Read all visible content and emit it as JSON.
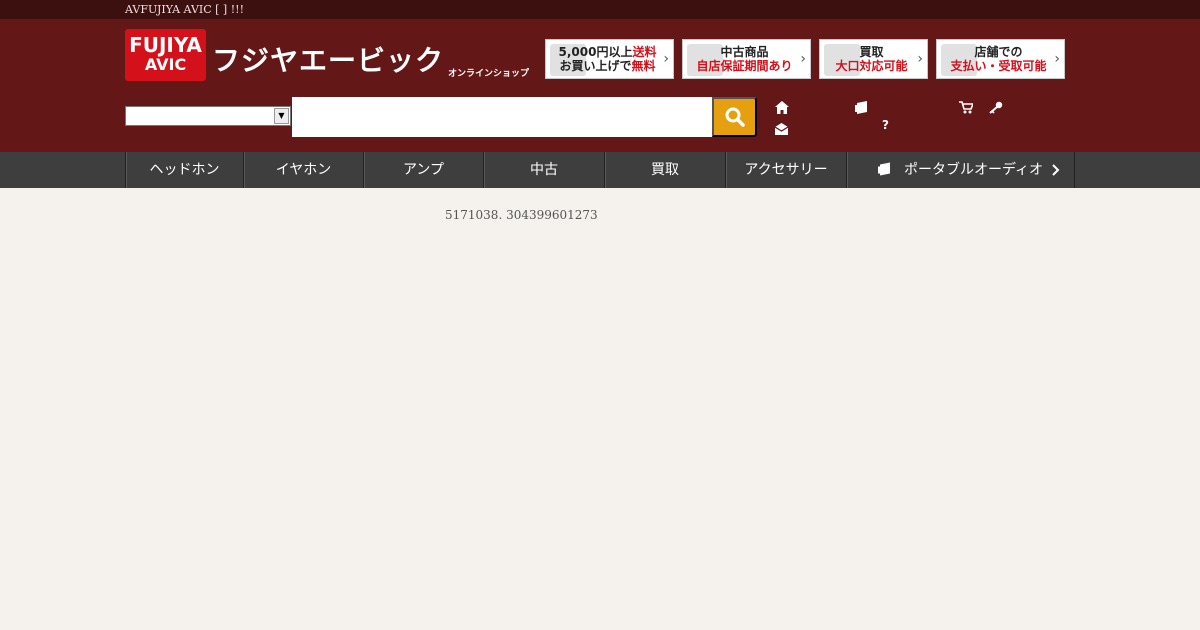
{
  "topbar": {
    "text": "AVFUJIYA AVIC [  ] !!!"
  },
  "logo": {
    "line1": "FUJIYA",
    "line2": "AVIC",
    "name": "フジヤエービック",
    "sub": "オンラインショップ"
  },
  "banners": [
    {
      "id": "free-shipping",
      "line1a": "5,000円以上",
      "line1b": "送料",
      "line2a": "お買い上げで",
      "line2b": "無料"
    },
    {
      "id": "used-warranty",
      "line1a": "中古商品",
      "line1b": "",
      "line2a": "",
      "line2b": "自店保証期間あり"
    },
    {
      "id": "buyback",
      "line1a": "買取",
      "line1b": "",
      "line2a": "",
      "line2b": "大口対応可能"
    },
    {
      "id": "store-payment",
      "line1a": "店舗での",
      "line1b": "",
      "line2a": "",
      "line2b": "支払い・受取可能"
    }
  ],
  "search": {
    "category_value": "",
    "input_value": "",
    "placeholder": ""
  },
  "user_links": [
    {
      "icon": "home-icon",
      "label": ""
    },
    {
      "icon": "store-icon",
      "label": ""
    },
    {
      "icon": "cart-icon",
      "label": ""
    },
    {
      "icon": "key-icon",
      "label": ""
    },
    {
      "icon": "mail-icon",
      "label": ""
    },
    {
      "icon": "help-icon",
      "label": "?"
    }
  ],
  "nav": [
    {
      "label": "ヘッドホン"
    },
    {
      "label": "イヤホン"
    },
    {
      "label": "アンプ"
    },
    {
      "label": "中古"
    },
    {
      "label": "買取"
    },
    {
      "label": "アクセサリー"
    },
    {
      "label": "ポータブルオーディオ"
    }
  ],
  "content": {
    "phone_text": "5171038.   304399601273"
  },
  "colors": {
    "header": "#631717",
    "topbar": "#3d1010",
    "nav": "#3e3e3e",
    "search_button": "#e6a00f",
    "background": "#f5f1ed",
    "brand_red": "#d4101b"
  }
}
